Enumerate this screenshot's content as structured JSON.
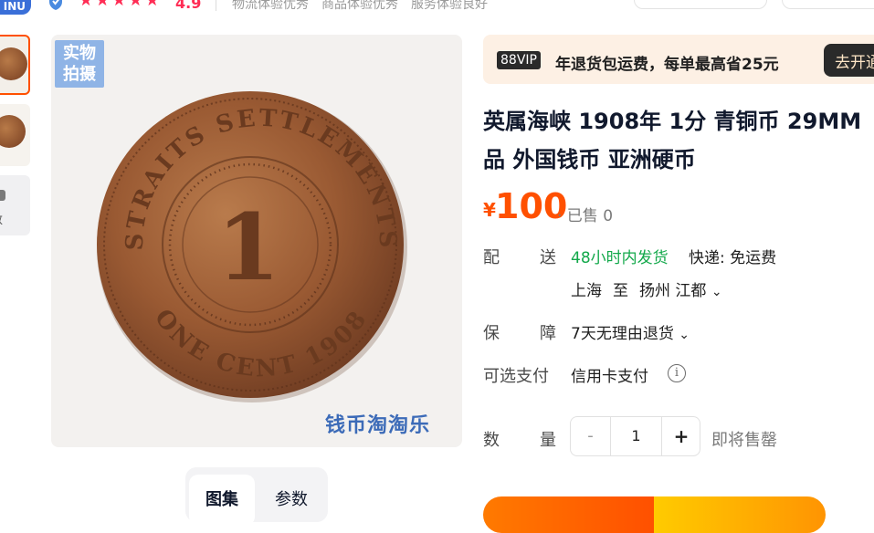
{
  "header": {
    "brand_badge": "INU",
    "rating": "4.9",
    "star_count": 5,
    "tags": [
      "物流体验优秀",
      "商品体验优秀",
      "服务体验良好"
    ]
  },
  "gallery": {
    "thumb3_label": "数",
    "stamp_line1": "实物",
    "stamp_line2": "拍摄",
    "watermark": "钱币淘淘乐",
    "coin_top_text": "STRAITS SETTLEMENTS",
    "coin_bottom_text": "ONE CENT 1908",
    "coin_denomination": "1",
    "tabs": [
      "图集",
      "参数"
    ]
  },
  "vip": {
    "badge": "88VIP",
    "text": "年退货包运费，每单最高省25元",
    "button": "去开通"
  },
  "product": {
    "title_line1": "英属海峡 1908年 1分 青铜币 29MM",
    "title_line2": "品 外国钱币 亚洲硬币",
    "currency": "¥",
    "price": "100",
    "sold": "· 已售 0"
  },
  "shipping": {
    "label": [
      "配",
      "送"
    ],
    "fast": "48小时内发货",
    "fee": "快递: 免运费",
    "from": "上海",
    "to_word": "至",
    "dest": "扬州 江都",
    "chevron": "⌄"
  },
  "guarantee": {
    "label": [
      "保",
      "障"
    ],
    "value": "7天无理由退货",
    "chevron": "⌄"
  },
  "payment": {
    "label": "可选支付",
    "value": "信用卡支付",
    "info_icon": "i"
  },
  "quantity": {
    "label": [
      "数",
      "量"
    ],
    "minus": "-",
    "value": "1",
    "plus": "+",
    "stock": "即将售罄"
  },
  "colors": {
    "accent": "#ff5000",
    "green": "#12a84a",
    "star": "#ff2d55"
  }
}
